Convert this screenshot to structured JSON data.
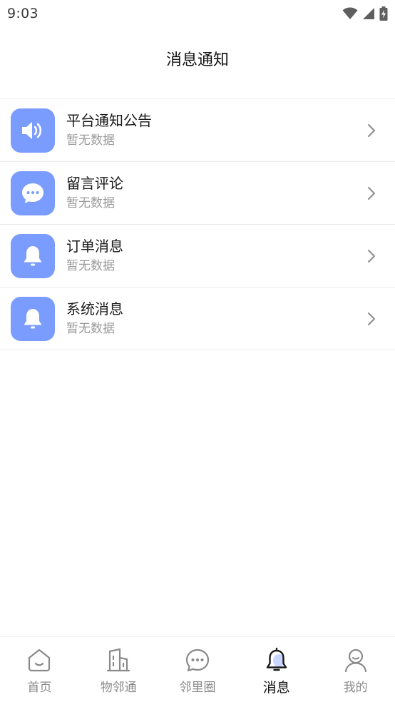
{
  "status_bar": {
    "time": "9:03"
  },
  "header": {
    "title": "消息通知"
  },
  "notices": [
    {
      "icon": "speaker-icon",
      "title": "平台通知公告",
      "subtitle": "暂无数据"
    },
    {
      "icon": "chat-bubble-icon",
      "title": "留言评论",
      "subtitle": "暂无数据"
    },
    {
      "icon": "bell-icon",
      "title": "订单消息",
      "subtitle": "暂无数据"
    },
    {
      "icon": "bell-icon",
      "title": "系统消息",
      "subtitle": "暂无数据"
    }
  ],
  "bottom_nav": {
    "active": "消息",
    "tabs": [
      {
        "icon": "home-icon",
        "label": "首页"
      },
      {
        "icon": "building-icon",
        "label": "物邻通"
      },
      {
        "icon": "chat-circle-icon",
        "label": "邻里圈"
      },
      {
        "icon": "bell-icon",
        "label": "消息"
      },
      {
        "icon": "user-icon",
        "label": "我的"
      }
    ]
  },
  "colors": {
    "accent": "#7b9cff",
    "subtitle_text": "#9a9a9a",
    "nav_inactive": "#8a8a8a"
  }
}
